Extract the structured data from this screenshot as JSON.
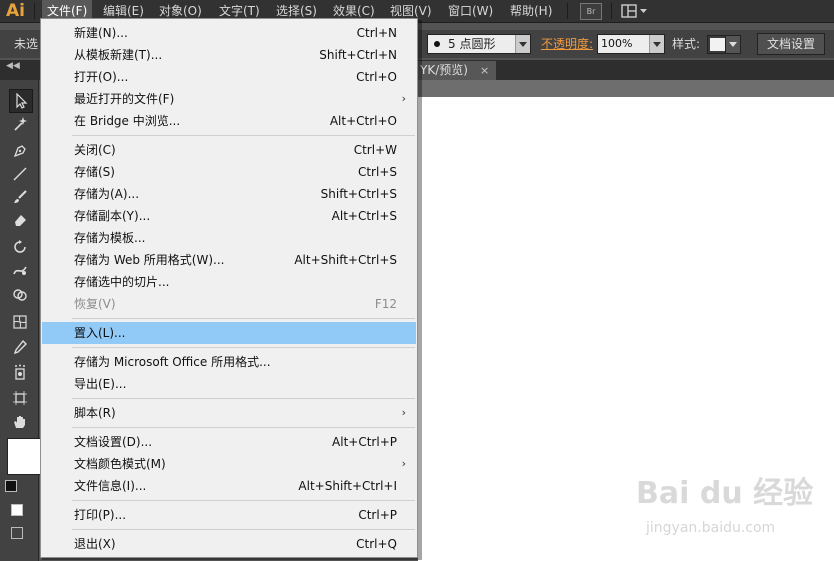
{
  "app": {
    "logo": "Ai"
  },
  "menubar": {
    "items": [
      {
        "label": "文件(F)"
      },
      {
        "label": "编辑(E)"
      },
      {
        "label": "对象(O)"
      },
      {
        "label": "文字(T)"
      },
      {
        "label": "选择(S)"
      },
      {
        "label": "效果(C)"
      },
      {
        "label": "视图(V)"
      },
      {
        "label": "窗口(W)"
      },
      {
        "label": "帮助(H)"
      }
    ],
    "bridge_label": "Br"
  },
  "controlbar": {
    "left_label": "未选",
    "brush_value": "5 点圆形",
    "opacity_label": "不透明度:",
    "opacity_value": "100%",
    "style_label": "样式:",
    "doc_setup_label": "文档设置"
  },
  "tab": {
    "title": "YK/预览)",
    "close": "×"
  },
  "file_menu": {
    "items": [
      {
        "label": "新建(N)...",
        "shortcut": "Ctrl+N"
      },
      {
        "label": "从模板新建(T)...",
        "shortcut": "Shift+Ctrl+N"
      },
      {
        "label": "打开(O)...",
        "shortcut": "Ctrl+O"
      },
      {
        "label": "最近打开的文件(F)",
        "shortcut": "",
        "submenu": "›"
      },
      {
        "label": "在 Bridge 中浏览...",
        "shortcut": "Alt+Ctrl+O"
      },
      {
        "label": "关闭(C)",
        "shortcut": "Ctrl+W"
      },
      {
        "label": "存储(S)",
        "shortcut": "Ctrl+S"
      },
      {
        "label": "存储为(A)...",
        "shortcut": "Shift+Ctrl+S"
      },
      {
        "label": "存储副本(Y)...",
        "shortcut": "Alt+Ctrl+S"
      },
      {
        "label": "存储为模板...",
        "shortcut": ""
      },
      {
        "label": "存储为 Web 所用格式(W)...",
        "shortcut": "Alt+Shift+Ctrl+S"
      },
      {
        "label": "存储选中的切片...",
        "shortcut": ""
      },
      {
        "label": "恢复(V)",
        "shortcut": "F12"
      },
      {
        "label": "置入(L)...",
        "shortcut": ""
      },
      {
        "label": "存储为 Microsoft Office 所用格式...",
        "shortcut": ""
      },
      {
        "label": "导出(E)...",
        "shortcut": ""
      },
      {
        "label": "脚本(R)",
        "shortcut": "",
        "submenu": "›"
      },
      {
        "label": "文档设置(D)...",
        "shortcut": "Alt+Ctrl+P"
      },
      {
        "label": "文档颜色模式(M)",
        "shortcut": "",
        "submenu": "›"
      },
      {
        "label": "文件信息(I)...",
        "shortcut": "Alt+Shift+Ctrl+I"
      },
      {
        "label": "打印(P)...",
        "shortcut": "Ctrl+P"
      },
      {
        "label": "退出(X)",
        "shortcut": "Ctrl+Q"
      }
    ],
    "highlighted": "置入(L)...",
    "disabled": "恢复(V)"
  },
  "watermark": {
    "text": "Bai du 经验",
    "url": "jingyan.baidu.com"
  },
  "colors": {
    "menu_highlight": "#91c9f7",
    "menubar_bg": "#323232",
    "opacity_label": "#f09a3e"
  }
}
